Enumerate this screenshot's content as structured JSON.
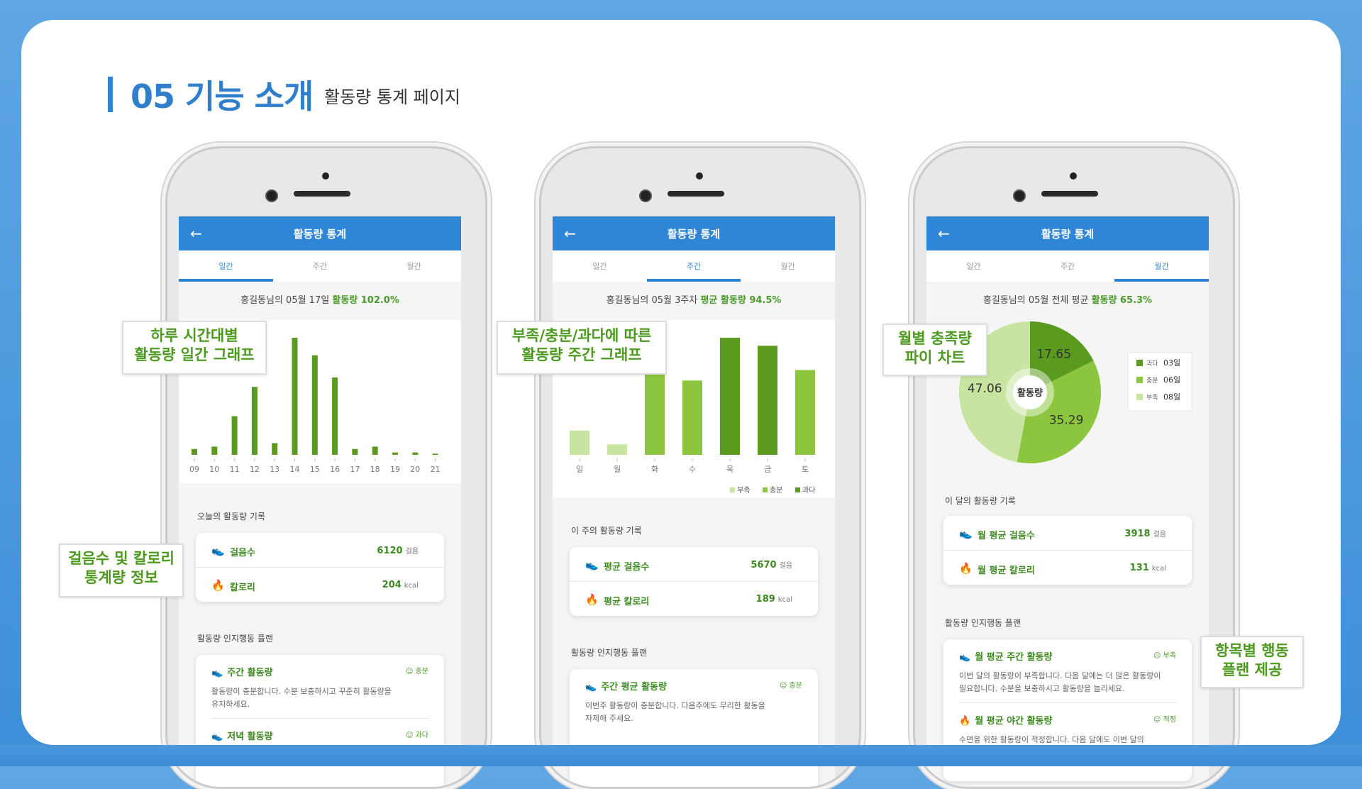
{
  "header": {
    "title": "05 기능 소개",
    "subtitle": "활동량 통계 페이지"
  },
  "app": {
    "title": "활동량 통계",
    "tabs": [
      "일간",
      "주간",
      "월간"
    ]
  },
  "phones": [
    {
      "summary_prefix": "홍길동님의 05월 17일",
      "summary_value": "활동량 102.0%",
      "record_title": "오늘의 활동량 기록",
      "rows": [
        {
          "label": "걸음수",
          "value": "6120",
          "unit": "걸음"
        },
        {
          "label": "칼로리",
          "value": "204",
          "unit": "kcal"
        }
      ],
      "plan_title": "활동량 인지행동 플랜",
      "plans": [
        {
          "title": "주간 활동량",
          "status": "충분",
          "desc1": "활동량이 충분합니다. 수분 보충하시고 꾸준히 활동량을",
          "desc2": "유지하세요."
        },
        {
          "title": "저녁 활동량",
          "status": "과다",
          "desc1": "",
          "desc2": ""
        }
      ]
    },
    {
      "summary_prefix": "홍길동님의 05월 3주차",
      "summary_value": "평균 활동량 94.5%",
      "record_title": "이 주의 활동량 기록",
      "rows": [
        {
          "label": "평균 걸음수",
          "value": "5670",
          "unit": "걸음"
        },
        {
          "label": "평균 칼로리",
          "value": "189",
          "unit": "kcal"
        }
      ],
      "plan_title": "활동량 인지행동 플랜",
      "plans": [
        {
          "title": "주간 평균 활동량",
          "status": "충분",
          "desc1": "이번주 활동량이 충분합니다. 다음주에도 무리한 활동을",
          "desc2": "자제해 주세요."
        }
      ],
      "legend": [
        "부족",
        "충분",
        "과다"
      ]
    },
    {
      "summary_prefix": "홍길동님의 05월 전체 평균",
      "summary_value": "활동량 65.3%",
      "record_title": "이 달의 활동량 기록",
      "rows": [
        {
          "label": "월 평균 걸음수",
          "value": "3918",
          "unit": "걸음"
        },
        {
          "label": "월 평균 칼로리",
          "value": "131",
          "unit": "kcal"
        }
      ],
      "plan_title": "활동량 인지행동 플랜",
      "plans": [
        {
          "title": "월 평균 주간 활동량",
          "status": "부족",
          "desc1": "이번 달의 활동량이 부족합니다. 다음 달에는 더 많은 활동량이",
          "desc2": "필요합니다. 수분을 보충하시고 활동량을 늘리세요."
        },
        {
          "title": "월 평균 야간 활동량",
          "status": "적정",
          "desc1": "수면을 위한 활동량이 적정합니다. 다음 달에도 이번 달의",
          "desc2": ""
        }
      ],
      "pie_center": "활동량",
      "legend": [
        {
          "label": "과다",
          "days": "03일"
        },
        {
          "label": "충분",
          "days": "06일"
        },
        {
          "label": "부족",
          "days": "08일"
        }
      ]
    }
  ],
  "callouts": {
    "c1": [
      "하루 시간대별",
      "활동량 일간 그래프"
    ],
    "c2": [
      "부족/충분/과다에 따른",
      "활동량 주간 그래프"
    ],
    "c3": [
      "월별 충족량",
      "파이 차트"
    ],
    "c4": [
      "걸음수 및 칼로리",
      "통계량 정보"
    ],
    "c5": [
      "항목별 행동",
      "플랜 제공"
    ]
  },
  "colors": {
    "primary": "#2f86d6",
    "green_dark": "#5a9a1e",
    "green_mid": "#8cc63f",
    "green_light": "#c7e4a0"
  },
  "chart_data": [
    {
      "type": "bar",
      "categories": [
        "09",
        "10",
        "11",
        "12",
        "13",
        "14",
        "15",
        "16",
        "17",
        "18",
        "19",
        "20",
        "21"
      ],
      "values": [
        5,
        7,
        33,
        58,
        10,
        100,
        85,
        66,
        5,
        7,
        2,
        2,
        1
      ]
    },
    {
      "type": "bar",
      "categories": [
        "일",
        "월",
        "화",
        "수",
        "목",
        "금",
        "토"
      ],
      "values": [
        30,
        13,
        105,
        92,
        145,
        135,
        105
      ],
      "levels": [
        "부족",
        "부족",
        "충분",
        "충분",
        "과다",
        "과다",
        "충분"
      ]
    },
    {
      "type": "pie",
      "labels": [
        "과다",
        "충분",
        "부족"
      ],
      "values": [
        17.65,
        35.29,
        47.06
      ]
    }
  ]
}
